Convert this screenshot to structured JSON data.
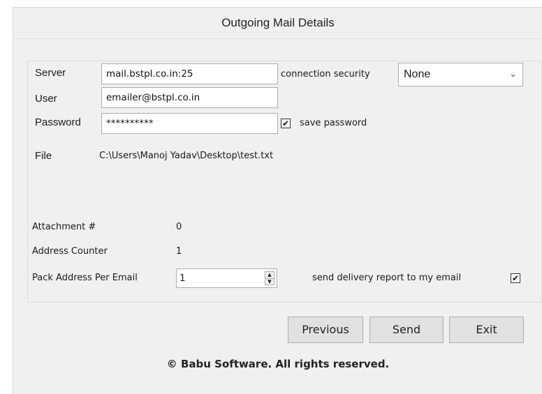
{
  "window": {
    "title": "Outgoing Mail Details"
  },
  "form": {
    "server_label": "Server",
    "server_value": "mail.bstpl.co.in:25",
    "user_label": "User",
    "user_value": "emailer@bstpl.co.in",
    "password_label": "Password",
    "password_value": "**********",
    "security_label": "connection security",
    "security_value": "None",
    "save_password_label": "save password",
    "save_password_checked": true,
    "file_label": "File",
    "file_value": "C:\\Users\\Manoj Yadav\\Desktop\\test.txt"
  },
  "stats": {
    "attachment_label": "Attachment #",
    "attachment_value": "0",
    "address_counter_label": "Address Counter",
    "address_counter_value": "1",
    "pack_label": "Pack Address Per Email",
    "pack_value": "1",
    "delivery_report_label": "send delivery report to my email",
    "delivery_report_checked": true
  },
  "buttons": {
    "previous": "Previous",
    "send": "Send",
    "exit": "Exit"
  },
  "footer": {
    "copyright": "© Babu Software. All rights reserved."
  },
  "icons": {
    "checkmark": "✔",
    "chevron": "⌄",
    "spin_up": "▲",
    "spin_down": "▼"
  }
}
